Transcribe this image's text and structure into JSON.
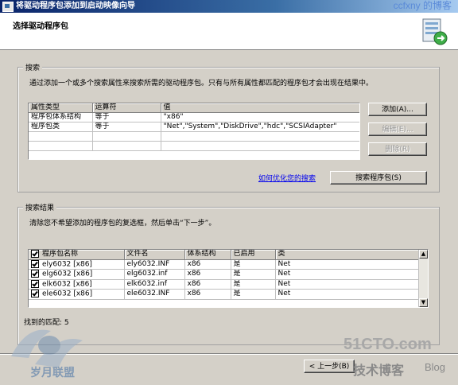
{
  "window": {
    "title": "将驱动程序包添加到启动映像向导",
    "watermark": "ccfxny 的博客"
  },
  "header": {
    "title": "选择驱动程序包",
    "icon": "driver-package-wizard-icon"
  },
  "search": {
    "group_label": "搜索",
    "description": "通过添加一个或多个搜索属性来搜索所需的驱动程序包。只有与所有属性都匹配的程序包才会出现在结果中。",
    "columns": [
      "属性类型",
      "运算符",
      "值"
    ],
    "rows": [
      {
        "type": "程序包体系结构",
        "op": "等于",
        "value": "\"x86\""
      },
      {
        "type": "程序包类",
        "op": "等于",
        "value": "\"Net\",\"System\",\"DiskDrive\",\"hdc\",\"SCSIAdapter\""
      }
    ],
    "add_button": "添加(A)...",
    "edit_button": "编辑(E)...",
    "delete_button": "删除(R)",
    "optimize_link": "如何优化您的搜索",
    "search_button": "搜索程序包(S)"
  },
  "results": {
    "group_label": "搜索结果",
    "description": "清除您不希望添加的程序包的复选框，然后单击“下一步”。",
    "columns": [
      "程序包名称",
      "文件名",
      "体系结构",
      "已启用",
      "类"
    ],
    "rows": [
      {
        "name": "ely6032 [x86]",
        "file": "ely6032.INF",
        "arch": "x86",
        "enabled": "是",
        "class": "Net"
      },
      {
        "name": "elg6032 [x86]",
        "file": "elg6032.inf",
        "arch": "x86",
        "enabled": "是",
        "class": "Net"
      },
      {
        "name": "elk6032 [x86]",
        "file": "elk6032.inf",
        "arch": "x86",
        "enabled": "是",
        "class": "Net"
      },
      {
        "name": "ele6032 [x86]",
        "file": "ele6032.INF",
        "arch": "x86",
        "enabled": "是",
        "class": "Net"
      }
    ],
    "count_label": "找到的匹配: 5"
  },
  "footer": {
    "back_button": "< 上一步(B)",
    "watermark_site": "51CTO.com",
    "watermark_blog": "技术博客",
    "watermark_blog_suffix": "Blog",
    "watermark_badge": "岁月联盟"
  }
}
